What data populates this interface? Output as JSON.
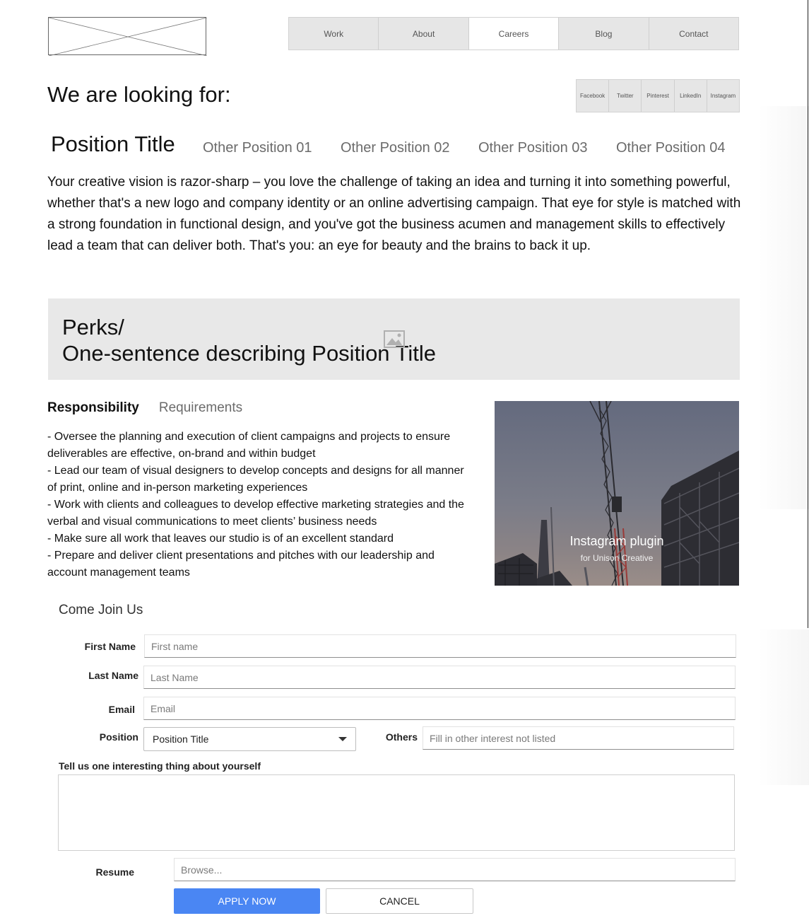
{
  "nav": {
    "items": [
      {
        "label": "Work"
      },
      {
        "label": "About"
      },
      {
        "label": "Careers"
      },
      {
        "label": "Blog"
      },
      {
        "label": "Contact"
      }
    ],
    "active": "Careers"
  },
  "header": {
    "title": "We are looking for:"
  },
  "social": {
    "items": [
      {
        "label": "Facebook"
      },
      {
        "label": "Twitter"
      },
      {
        "label": "Pinterest"
      },
      {
        "label": "LinkedIn"
      },
      {
        "label": "Instagram"
      }
    ]
  },
  "positions": {
    "current": "Position Title",
    "others": [
      "Other Position 01",
      "Other Position 02",
      "Other Position 03",
      "Other Position 04"
    ]
  },
  "intro": "Your creative vision is razor-sharp – you love the challenge of taking an idea and turning it into something powerful, whether that's a new logo and company identity or an online advertising campaign. That eye for style is matched with a strong foundation in functional design, and you've got the business acumen and management skills to effectively lead a team that can deliver both. That's you: an eye for beauty and the brains to back it up.",
  "perks": {
    "line1": "Perks/",
    "line2": "One-sentence describing Position Title",
    "icon": "image-placeholder-icon"
  },
  "details": {
    "tabs": [
      "Responsibility",
      "Requirements"
    ],
    "active_tab": "Responsibility",
    "items": [
      "- Oversee the planning and execution of client campaigns and projects to ensure deliverables are effective, on-brand and within budget",
      "- Lead our team of visual designers to develop concepts and designs for all manner of print, online and in-person marketing experiences",
      "- Work with clients and colleagues to develop effective marketing strategies and the verbal and visual communications to meet clients’ business needs",
      "- Make sure all work that leaves our studio is of an excellent standard",
      "- Prepare and deliver client presentations and pitches with our leadership and account management teams"
    ]
  },
  "instagram": {
    "title": "Instagram plugin",
    "subtitle": "for Unison Creative"
  },
  "form": {
    "heading": "Come Join Us",
    "first_name": {
      "label": "First Name",
      "placeholder": "First name",
      "value": ""
    },
    "last_name": {
      "label": "Last Name",
      "placeholder": "Last Name",
      "value": ""
    },
    "email": {
      "label": "Email",
      "placeholder": "Email",
      "value": ""
    },
    "position": {
      "label": "Position",
      "selected": "Position Title"
    },
    "others": {
      "label": "Others",
      "placeholder": "Fill in other interest not listed",
      "value": ""
    },
    "about": {
      "label": "Tell us one interesting thing about yourself",
      "value": ""
    },
    "resume": {
      "label": "Resume",
      "placeholder": "Browse..."
    },
    "apply_label": "APPLY NOW",
    "cancel_label": "CANCEL"
  },
  "colors": {
    "apply_button": "#4a86f3",
    "nav_background": "#e6e6e6",
    "perks_background": "#e8e8e8"
  }
}
